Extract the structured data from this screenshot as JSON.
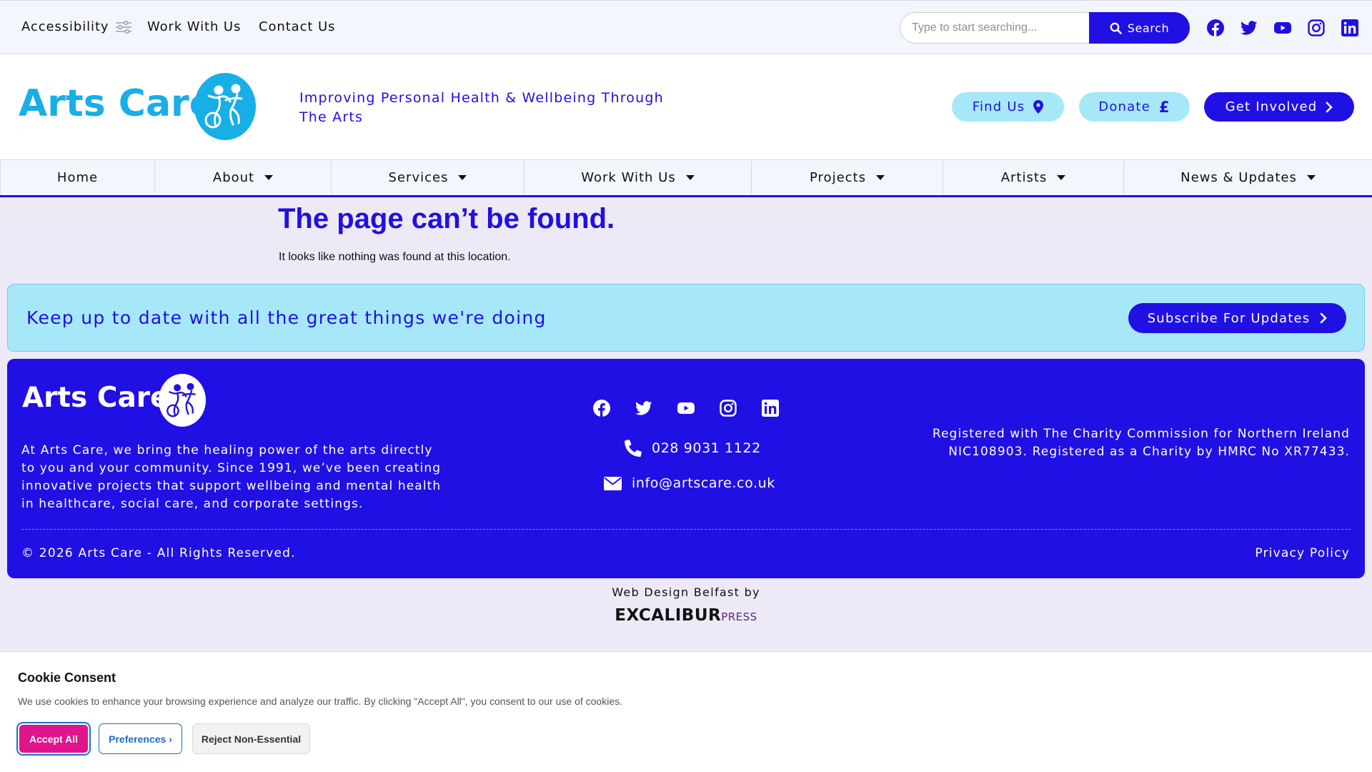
{
  "topbar": {
    "accessibility": "Accessibility",
    "work_with_us": "Work With Us",
    "contact_us": "Contact Us",
    "search_placeholder": "Type to start searching...",
    "search_button": "Search",
    "social_icons": [
      "facebook-icon",
      "twitter-icon",
      "youtube-icon",
      "instagram-icon",
      "linkedin-icon"
    ]
  },
  "header": {
    "brand": "Arts Care",
    "tagline": "Improving Personal Health & Wellbeing Through The Arts",
    "find_us": "Find Us",
    "donate": "Donate",
    "donate_symbol": "£",
    "get_involved": "Get Involved"
  },
  "nav": {
    "items": [
      "Home",
      "About",
      "Services",
      "Work With Us",
      "Projects",
      "Artists",
      "News & Updates"
    ]
  },
  "main": {
    "title": "The page can’t be found.",
    "subtitle": "It looks like nothing was found at this location."
  },
  "subscribe": {
    "text": "Keep up to date with all the great things we're doing",
    "button": "Subscribe For Updates"
  },
  "footer": {
    "brand": "Arts Care",
    "about": "At Arts Care, we bring the healing power of the arts directly to you and your community. Since 1991, we’ve been creating innovative projects that support wellbeing and mental health in healthcare, social care, and corporate settings.",
    "phone": "028 9031 1122",
    "email": "info@artscare.co.uk",
    "registration": "Registered with The Charity Commission for Northern Ireland NIC108903. Registered as a Charity by HMRC No XR77433.",
    "copyright": "© 2026 Arts Care - All Rights Reserved.",
    "privacy": "Privacy Policy"
  },
  "credit": {
    "text": "Web Design Belfast by",
    "logo_main": "EXCALIBUR",
    "logo_sub": "PRESS"
  },
  "cookie": {
    "title": "Cookie Consent",
    "text": "We use cookies to enhance your browsing experience and analyze our traffic. By clicking \"Accept All\", you consent to our use of cookies.",
    "accept": "Accept All",
    "preferences": "Preferences ›",
    "reject": "Reject Non-Essential"
  },
  "colors": {
    "brand_blue": "#2010e3",
    "brand_cyan": "#18aee6",
    "light_cyan": "#a6e8f9",
    "accept_pink": "#e0158b",
    "page_bg": "#eee9f6"
  }
}
